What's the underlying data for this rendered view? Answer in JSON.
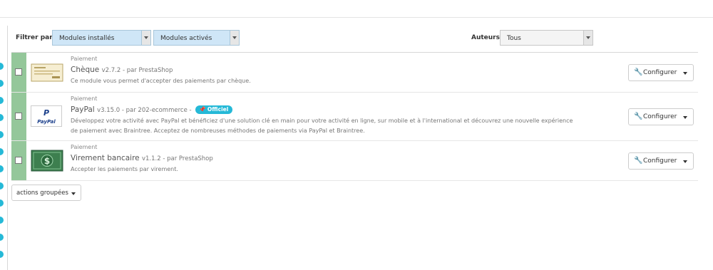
{
  "filter": {
    "label": "Filtrer par",
    "installed": "Modules installés",
    "enabled": "Modules activés",
    "authors_label": "Auteurs",
    "authors_value": "Tous"
  },
  "modules": [
    {
      "category": "Paiement",
      "name": "Chèque",
      "version": "v2.7.2 - par PrestaShop",
      "description": "Ce module vous permet d'accepter des paiements par chèque.",
      "configure": "Configurer",
      "logo": "cheque-logo"
    },
    {
      "category": "Paiement",
      "name": "PayPal",
      "version": "v3.15.0 - par 202-ecommerce -",
      "badge": "Officiel",
      "description_line1": "Développez votre activité avec PayPal et bénéficiez d'une solution clé en main pour votre activité en ligne, sur mobile et à l'international et découvrez une nouvelle expérience",
      "description_line2": "de paiement avec Braintree. Acceptez de nombreuses méthodes de paiements via PayPal et Braintree.",
      "configure": "Configurer",
      "logo_text": "PayPal"
    },
    {
      "category": "Paiement",
      "name": "Virement bancaire",
      "version": "v1.1.2 - par PrestaShop",
      "description": "Accepter les paiements par virement.",
      "configure": "Configurer",
      "logo": "banknote-logo"
    }
  ],
  "bulk_actions": "actions groupées",
  "colors": {
    "accent": "#25b9d7",
    "enabled_bar": "#94c79a"
  }
}
